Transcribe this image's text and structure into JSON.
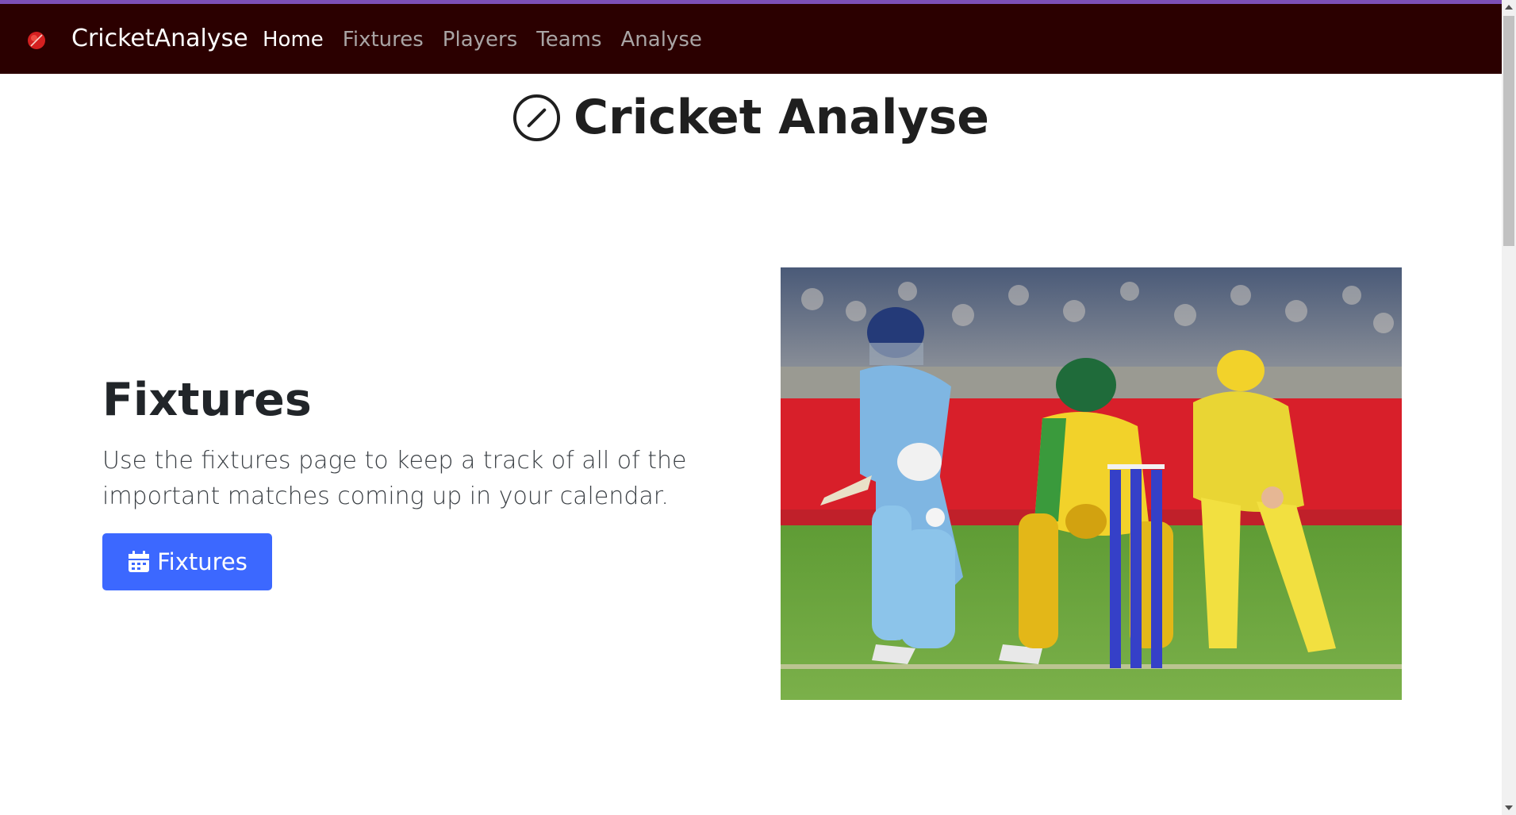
{
  "navbar": {
    "brand": "CricketAnalyse",
    "brand_icon": "cricket-ball-icon",
    "background": "#2b0000",
    "links": [
      {
        "label": "Home",
        "active": true
      },
      {
        "label": "Fixtures",
        "active": false
      },
      {
        "label": "Players",
        "active": false
      },
      {
        "label": "Teams",
        "active": false
      },
      {
        "label": "Analyse",
        "active": false
      }
    ]
  },
  "header": {
    "title": "Cricket Analyse",
    "icon": "slash-circle-icon"
  },
  "feature": {
    "heading": "Fixtures",
    "description": "Use the fixtures page to keep a track of all of the important matches coming up in your calendar.",
    "button_label": "Fixtures",
    "button_icon": "calendar-icon",
    "button_color": "#3c68ff"
  },
  "hero": {
    "image": "cricket-match-photo"
  },
  "colors": {
    "accent_bar": "#7d4fb6",
    "text": "#212529"
  }
}
